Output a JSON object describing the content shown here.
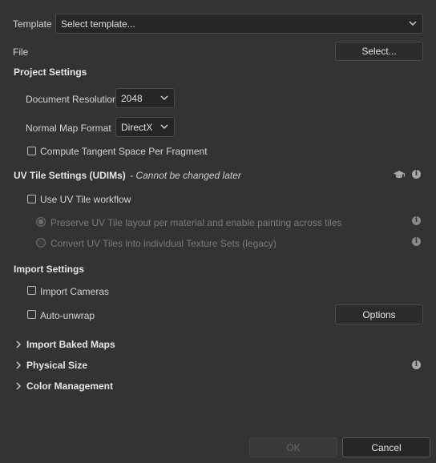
{
  "template": {
    "label": "Template",
    "value": "Select template..."
  },
  "file": {
    "label": "File",
    "button": "Select..."
  },
  "project_settings": {
    "heading": "Project Settings",
    "document_resolution": {
      "label": "Document Resolution",
      "value": "2048"
    },
    "normal_map_format": {
      "label": "Normal Map Format",
      "value": "DirectX"
    },
    "compute_tangent": {
      "label": "Compute Tangent Space Per Fragment",
      "checked": false
    }
  },
  "uv_tile": {
    "heading": "UV Tile Settings (UDIMs)",
    "note": "- Cannot be changed later",
    "use_workflow": {
      "label": "Use UV Tile workflow",
      "checked": false
    },
    "preserve_option": "Preserve UV Tile layout per material and enable painting across tiles",
    "convert_option": "Convert UV Tiles into individual Texture Sets (legacy)"
  },
  "import_settings": {
    "heading": "Import Settings",
    "import_cameras": {
      "label": "Import Cameras",
      "checked": false
    },
    "auto_unwrap": {
      "label": "Auto-unwrap",
      "checked": false
    },
    "options_button": "Options"
  },
  "sections": {
    "baked_maps": "Import Baked Maps",
    "physical_size": "Physical Size",
    "color_management": "Color Management"
  },
  "footer": {
    "ok": "OK",
    "cancel": "Cancel"
  }
}
